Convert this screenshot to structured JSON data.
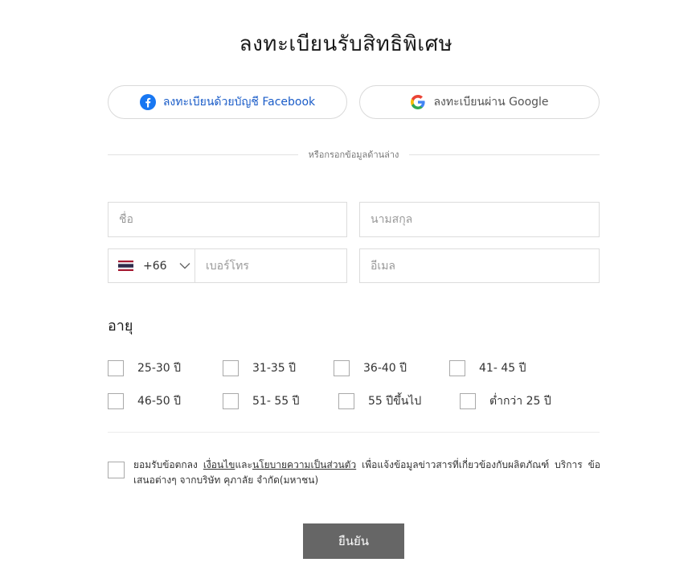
{
  "page": {
    "title": "ลงทะเบียนรับสิทธิพิเศษ"
  },
  "social": {
    "facebook_label": "ลงทะเบียนด้วยบัญชี Facebook",
    "google_label": "ลงทะเบียนผ่าน Google",
    "facebook_color": "#1877F2"
  },
  "divider_text": "หรือกรอกข้อมูลด้านล่าง",
  "form": {
    "first_name": {
      "placeholder": "ชื่อ",
      "value": ""
    },
    "last_name": {
      "placeholder": "นามสกุล",
      "value": ""
    },
    "phone_code": "+66",
    "phone": {
      "placeholder": "เบอร์โทร",
      "value": ""
    },
    "email": {
      "placeholder": "อีเมล",
      "value": ""
    }
  },
  "age": {
    "label": "อายุ",
    "options": [
      "25-30 ปี",
      "31-35 ปี",
      "36-40 ปี",
      "41- 45 ปี",
      "46-50 ปี",
      "51- 55 ปี",
      "55 ปีขึ้นไป",
      "ต่ำกว่า 25 ปี"
    ]
  },
  "consent": {
    "prefix": "ยอมรับข้อตกลง ",
    "terms_link": "เงื่อนไข",
    "and": "และ",
    "privacy_link": "นโยบายความเป็นส่วนตัว",
    "suffix": " เพื่อแจ้งข้อมูลข่าวสารที่เกี่ยวข้องกับผลิตภัณฑ์ บริการ ข้อเสนอต่างๆ จากบริษัท คุภาลัย จำกัด(มหาชน)"
  },
  "submit_label": "ยืนยัน",
  "colors": {
    "button": "#666666",
    "border": "#dcdcdc",
    "link": "#1a5cc8"
  }
}
